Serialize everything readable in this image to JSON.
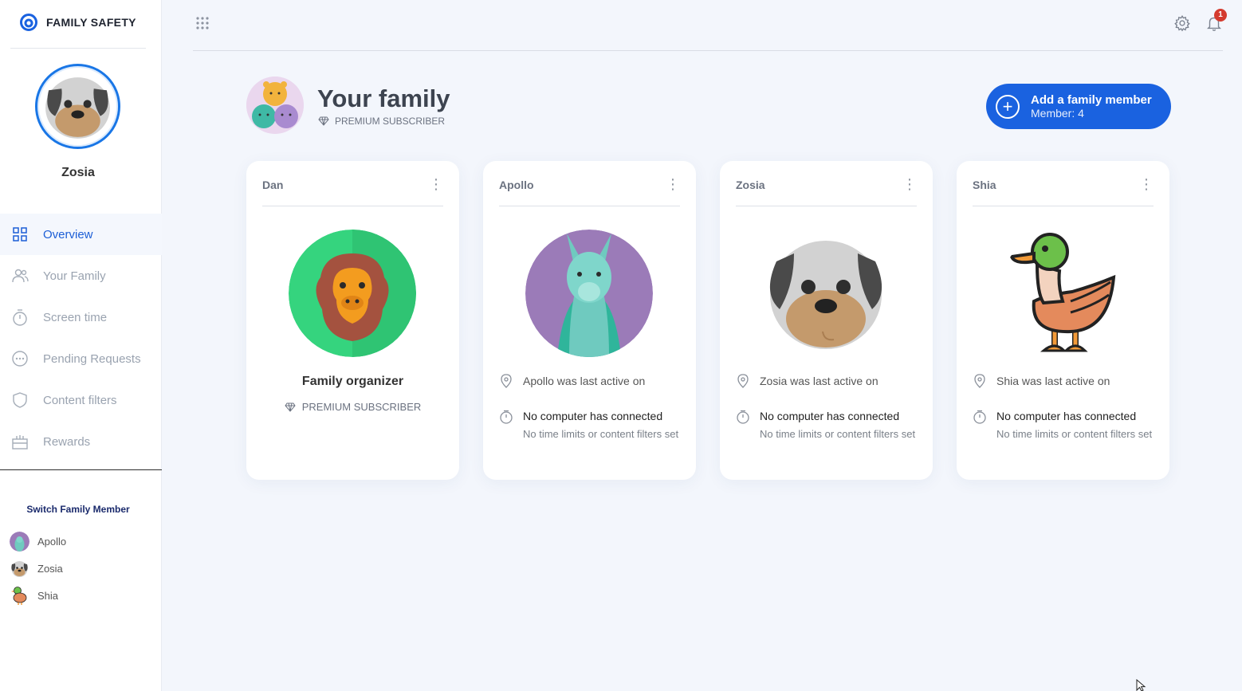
{
  "app": {
    "brand": "FAMILY SAFETY",
    "brand_color": "#1a62e0"
  },
  "sidebar": {
    "profile_name": "Zosia",
    "nav": [
      {
        "label": "Overview",
        "icon": "grid-icon",
        "active": true
      },
      {
        "label": "Your Family",
        "icon": "people-icon",
        "active": false
      },
      {
        "label": "Screen time",
        "icon": "timer-icon",
        "active": false
      },
      {
        "label": "Pending Requests",
        "icon": "pending-icon",
        "active": false
      },
      {
        "label": "Content filters",
        "icon": "shield-icon",
        "active": false
      },
      {
        "label": "Rewards",
        "icon": "gift-icon",
        "active": false
      }
    ],
    "switch_title": "Switch Family Member",
    "members": [
      {
        "name": "Apollo",
        "icon": "llama-avatar"
      },
      {
        "name": "Zosia",
        "icon": "dog-avatar"
      },
      {
        "name": "Shia",
        "icon": "duck-avatar"
      }
    ]
  },
  "topbar": {
    "notification_count": "1"
  },
  "header": {
    "title": "Your family",
    "subscription": "PREMIUM SUBSCRIBER",
    "add_button": {
      "label": "Add a family member",
      "sub": "Member: 4"
    }
  },
  "cards": [
    {
      "name": "Dan",
      "role": "Family organizer",
      "subscription": "PREMIUM SUBSCRIBER",
      "avatar": "lion-avatar"
    },
    {
      "name": "Apollo",
      "last_active": "Apollo was last active on",
      "connection": "No computer has connected",
      "limits": "No time limits or content filters set",
      "avatar": "llama-avatar"
    },
    {
      "name": "Zosia",
      "last_active": "Zosia was last active on",
      "connection": "No computer has connected",
      "limits": "No time limits or content filters set",
      "avatar": "dog-avatar"
    },
    {
      "name": "Shia",
      "last_active": "Shia was last active on",
      "connection": "No computer has connected",
      "limits": "No time limits or content filters set",
      "avatar": "duck-avatar"
    }
  ]
}
